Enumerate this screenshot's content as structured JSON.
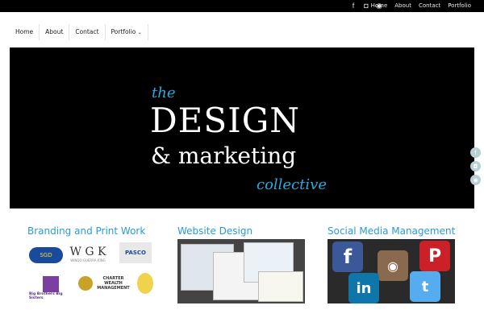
{
  "topbar": {
    "social_icons": [
      "facebook-icon",
      "instagram-icon",
      "rss-icon"
    ],
    "links": [
      "Home",
      "About",
      "Contact",
      "Portfolio"
    ]
  },
  "nav": {
    "items": [
      "Home",
      "About",
      "Contact",
      "Portfolio"
    ]
  },
  "hero": {
    "line1": "the",
    "line2": "DESIGN",
    "line3": "& marketing",
    "line4": "collective"
  },
  "columns": [
    {
      "title": "Branding and Print Work"
    },
    {
      "title": "Website Design"
    },
    {
      "title": "Social Media Management"
    }
  ],
  "branding_logos": {
    "sgd": "SGD",
    "wgk": "W G K",
    "wgk_sub": "WINDO GUERRA KING",
    "pasco": "PASCO",
    "bbbs": "Big Brothers Big Sisters",
    "charter": "CHARTER WEALTH MANAGEMENT"
  },
  "colors": {
    "accent": "#2b9bd3",
    "topbar": "#000000",
    "hero_bg": "#000000"
  },
  "side_social": [
    "facebook-icon",
    "instagram-icon",
    "rss-icon"
  ]
}
